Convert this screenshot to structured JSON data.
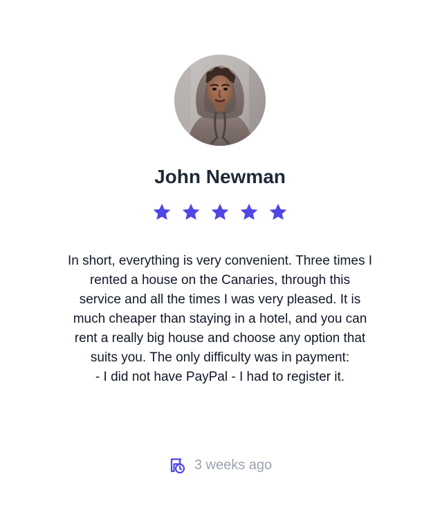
{
  "review_card": {
    "reviewer_name": "John Newman",
    "rating": 5,
    "rating_max": 5,
    "review_text": "In short, everything is very convenient. Three times I\nrented a house on the Canaries, through this\nservice and all the times I was very pleased. It is\nmuch cheaper than staying in a hotel, and you can\nrent a really big house and choose any option that\nsuits you. The only difficulty was in payment:\n- I did not have PayPal - I had to register it.",
    "time_ago": "3 weeks ago",
    "icons": {
      "star": "star-icon",
      "time": "calendar-clock-icon"
    },
    "colors": {
      "star": "#4f46e5",
      "time_icon": "#4f46e5",
      "muted_text": "#9ca3af",
      "name_text": "#1f2937"
    }
  }
}
